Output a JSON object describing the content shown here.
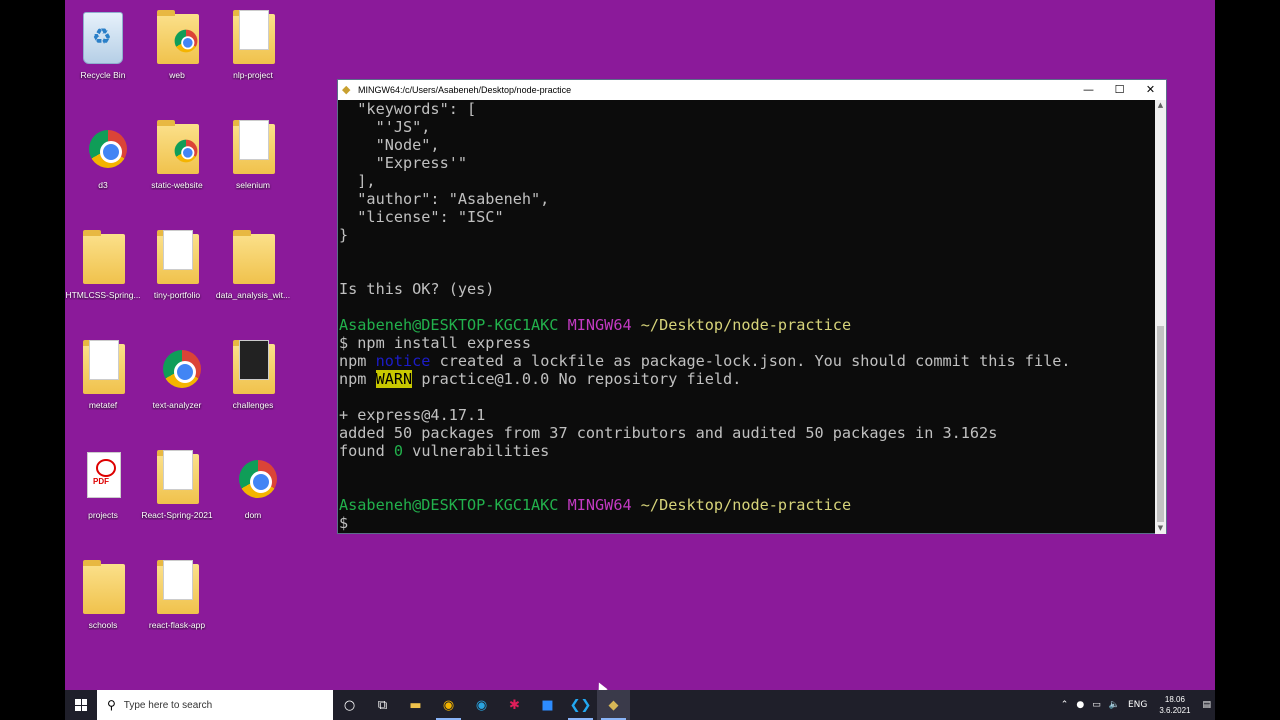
{
  "desktop": {
    "icons": [
      {
        "label": "Recycle Bin",
        "kind": "recycle-bin-icon"
      },
      {
        "label": "web",
        "kind": "folder-icon"
      },
      {
        "label": "nlp-project",
        "kind": "folder-icon"
      },
      {
        "label": "d3",
        "kind": "chrome-icon"
      },
      {
        "label": "static-website",
        "kind": "folder-icon"
      },
      {
        "label": "selenium",
        "kind": "folder-icon"
      },
      {
        "label": "HTMLCSS-Spring...",
        "kind": "folder-icon"
      },
      {
        "label": "tiny-portfolio",
        "kind": "folder-icon"
      },
      {
        "label": "data_analysis_wit...",
        "kind": "folder-icon"
      },
      {
        "label": "metatef",
        "kind": "folder-icon"
      },
      {
        "label": "text-analyzer",
        "kind": "chrome-icon"
      },
      {
        "label": "challenges",
        "kind": "folder-icon"
      },
      {
        "label": "projects",
        "kind": "pdf-icon"
      },
      {
        "label": "React-Spring-2021",
        "kind": "folder-icon"
      },
      {
        "label": "dom",
        "kind": "chrome-icon"
      },
      {
        "label": "schools",
        "kind": "folder-icon"
      },
      {
        "label": "react-flask-app",
        "kind": "folder-icon"
      }
    ]
  },
  "window": {
    "title": "MINGW64:/c/Users/Asabeneh/Desktop/node-practice",
    "minimize": "—",
    "maximize": "☐",
    "close": "✕"
  },
  "terminal": {
    "l1": "  \"keywords\": [",
    "l2": "    \"'JS\",",
    "l3": "    \"Node\",",
    "l4": "    \"Express'\"",
    "l5": "  ],",
    "l6": "  \"author\": \"Asabeneh\",",
    "l7": "  \"license\": \"ISC\"",
    "l8": "}",
    "l9": "Is this OK? (yes)",
    "prompt_user": "Asabeneh@DESKTOP-KGC1AKC",
    "prompt_env": "MINGW64",
    "prompt_path": "~/Desktop/node-practice",
    "cmd1": "$ npm install express",
    "npm": "npm",
    "notice": "notice",
    "notice_msg": " created a lockfile as package-lock.json. You should commit this file.",
    "warn": "WARN",
    "warn_msg": " practice@1.0.0 No repository field.",
    "l_express": "+ express@4.17.1",
    "l_added": "added 50 packages from 37 contributors and audited 50 packages in 3.162s",
    "found_pre": "found ",
    "found_num": "0",
    "found_post": " vulnerabilities",
    "cursor_prompt": "$"
  },
  "taskbar": {
    "search_placeholder": "Type here to search",
    "lang": "ENG",
    "time": "18.06",
    "date": "3.6.2021"
  }
}
